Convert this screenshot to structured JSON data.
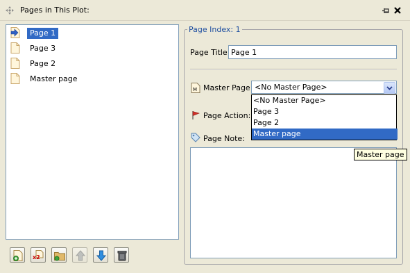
{
  "window": {
    "title": "Pages in This Plot:"
  },
  "pages": [
    {
      "label": "Page 1",
      "selected": true
    },
    {
      "label": "Page 3",
      "selected": false
    },
    {
      "label": "Page 2",
      "selected": false
    },
    {
      "label": "Master page",
      "selected": false
    }
  ],
  "toolbar": {
    "buttons": [
      "new-page-icon",
      "duplicate-page-icon",
      "folder-icon",
      "move-up-icon",
      "move-down-icon",
      "delete-icon"
    ],
    "duplicate_badge": "x2"
  },
  "properties": {
    "legend": "Page Index: 1",
    "title_label": "Page Title:",
    "title_value": "Page 1",
    "master_label": "Master Page:",
    "master_value": "<No Master Page>",
    "master_options": [
      "<No Master Page>",
      "Page 3",
      "Page 2",
      "Master page"
    ],
    "master_highlighted": "Master page",
    "action_label": "Page Action:",
    "note_label": "Page Note:",
    "note_value": "",
    "tooltip": "Master page"
  },
  "colors": {
    "selection": "#316ac5",
    "panel": "#ece9d8",
    "accent_text": "#1f4fa0"
  }
}
